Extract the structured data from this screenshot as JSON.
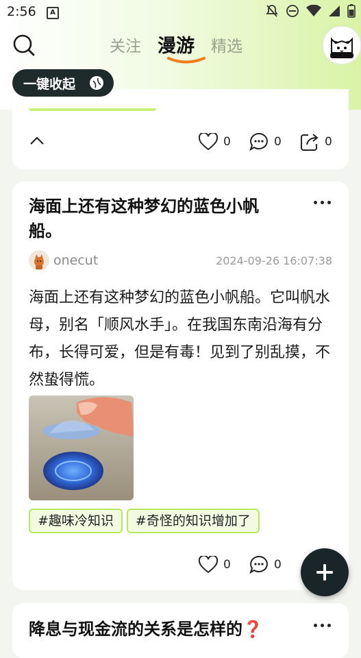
{
  "status_bar": {
    "time": "2:56",
    "a_badge": "A"
  },
  "nav": {
    "tabs": [
      {
        "label": "关注",
        "active": false
      },
      {
        "label": "漫游",
        "active": true
      },
      {
        "label": "精选",
        "active": false
      }
    ]
  },
  "collapse_all_label": "一键收起",
  "prev_post": {
    "likes": "0",
    "comments": "0",
    "shares": "0"
  },
  "post": {
    "title": "海面上还有这种梦幻的蓝色小帆船。",
    "author": "onecut",
    "datetime": "2024-09-26 16:07:38",
    "body": "海面上还有这种梦幻的蓝色小帆船。它叫帆水母，别名「顺风水手」。在我国东南沿海有分布，长得可爱，但是有毒！见到了别乱摸，不然蛰得慌。",
    "tags": [
      "#趣味冷知识",
      "#奇怪的知识增加了"
    ],
    "likes": "0",
    "comments": "0"
  },
  "next_post": {
    "title": "降息与现金流的关系是怎样的❓"
  },
  "colors": {
    "accent": "#c8f07a",
    "dark": "#1a2529"
  }
}
